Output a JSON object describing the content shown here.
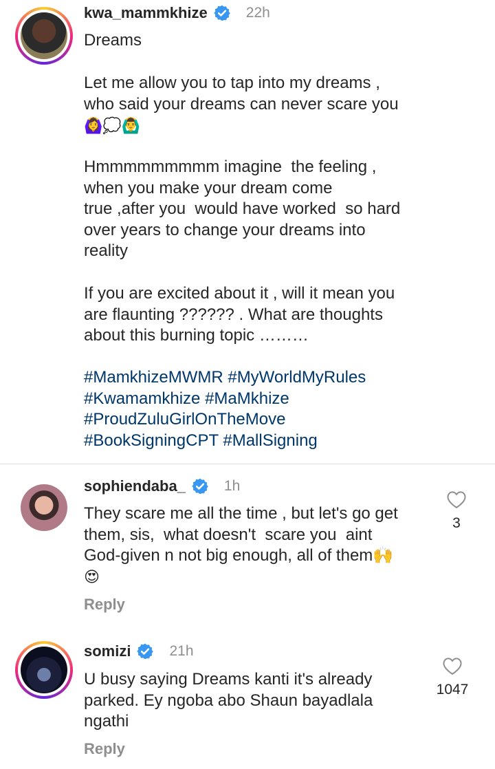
{
  "post": {
    "username": "kwa_mammkhize",
    "time": "22h",
    "title": "Dreams",
    "paragraph1": "Let me allow you to tap into my dreams ,\nwho said your dreams can never scare you",
    "emoji_line": "🙆‍♀️💭🙆‍♂️",
    "paragraph2": "Hmmmmmmmmm imagine  the feeling ,\nwhen you make your dream come\ntrue ,after you  would have worked  so hard\nover years to change your dreams into\nreality",
    "paragraph3": "If you are excited about it , will it mean you\nare flaunting ?????? . What are thoughts\nabout this burning topic ………",
    "hashtags": "#MamkhizeMWMR #MyWorldMyRules\n#Kwamamkhize #MaMkhize\n#ProudZuluGirlOnTheMove\n#BookSigningCPT #MallSigning"
  },
  "comments": [
    {
      "username": "sophiendaba_",
      "time": "1h",
      "text": "They scare me all the time , but let's go get\nthem, sis,  what doesn't  scare you  aint\nGod-given n not big enough, all of them🙌",
      "emoji_line": "😍",
      "likes": "3",
      "reply_label": "Reply"
    },
    {
      "username": "somizi",
      "time": "21h",
      "text": "U busy saying Dreams kanti it's already\nparked. Ey ngoba abo Shaun bayadlala\nngathi",
      "likes": "1047",
      "reply_label": "Reply"
    }
  ],
  "colors": {
    "hashtag": "#00376b",
    "verified": "#3897f0",
    "muted": "#8e8e8e"
  },
  "icons": [
    "verified-badge-icon",
    "heart-outline-icon"
  ]
}
